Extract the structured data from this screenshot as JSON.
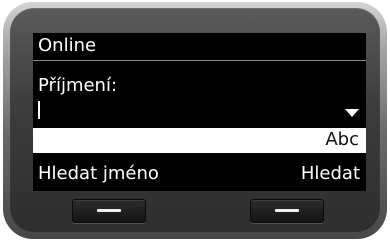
{
  "screen": {
    "title": "Online",
    "field_label": "Příjmení:",
    "field_value": "",
    "input_mode": "Abc",
    "softkey_left": "Hledat jméno",
    "softkey_right": "Hledat"
  },
  "icons": {
    "dropdown": "chevron-down-icon",
    "hardware_key": "minus-icon"
  },
  "colors": {
    "screen_background": "#000000",
    "text": "#ffffff",
    "highlight_bar": "#ffffff",
    "highlight_text": "#111111"
  }
}
